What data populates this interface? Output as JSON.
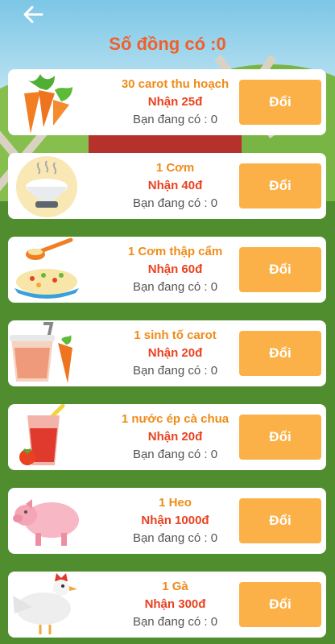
{
  "header": {
    "back_icon": "arrow-left-icon",
    "title": "Số đồng có :0"
  },
  "colors": {
    "title": "#f0602a",
    "item_name": "#ef8c19",
    "reward": "#e94220",
    "button": "#fbb147"
  },
  "items": [
    {
      "icon": "carrot-icon",
      "name": "30 carot thu hoạch",
      "reward": "Nhận 25đ",
      "have": "Bạn đang có : 0",
      "button": "Đổi"
    },
    {
      "icon": "rice-bowl-icon",
      "name": "1 Cơm",
      "reward": "Nhận 40đ",
      "have": "Bạn đang có : 0",
      "button": "Đổi"
    },
    {
      "icon": "fried-rice-icon",
      "name": "1 Cơm thập cẩm",
      "reward": "Nhận 60đ",
      "have": "Bạn đang có : 0",
      "button": "Đổi"
    },
    {
      "icon": "carrot-smoothie-icon",
      "name": "1 sinh tố carot",
      "reward": "Nhận 20đ",
      "have": "Bạn đang có : 0",
      "button": "Đổi"
    },
    {
      "icon": "tomato-juice-icon",
      "name": "1 nước ép cà chua",
      "reward": "Nhận 20đ",
      "have": "Bạn đang có : 0",
      "button": "Đổi"
    },
    {
      "icon": "pig-icon",
      "name": "1 Heo",
      "reward": "Nhận 1000đ",
      "have": "Bạn đang có : 0",
      "button": "Đổi"
    },
    {
      "icon": "chicken-icon",
      "name": "1 Gà",
      "reward": "Nhận 300đ",
      "have": "Bạn đang có : 0",
      "button": "Đổi"
    }
  ]
}
